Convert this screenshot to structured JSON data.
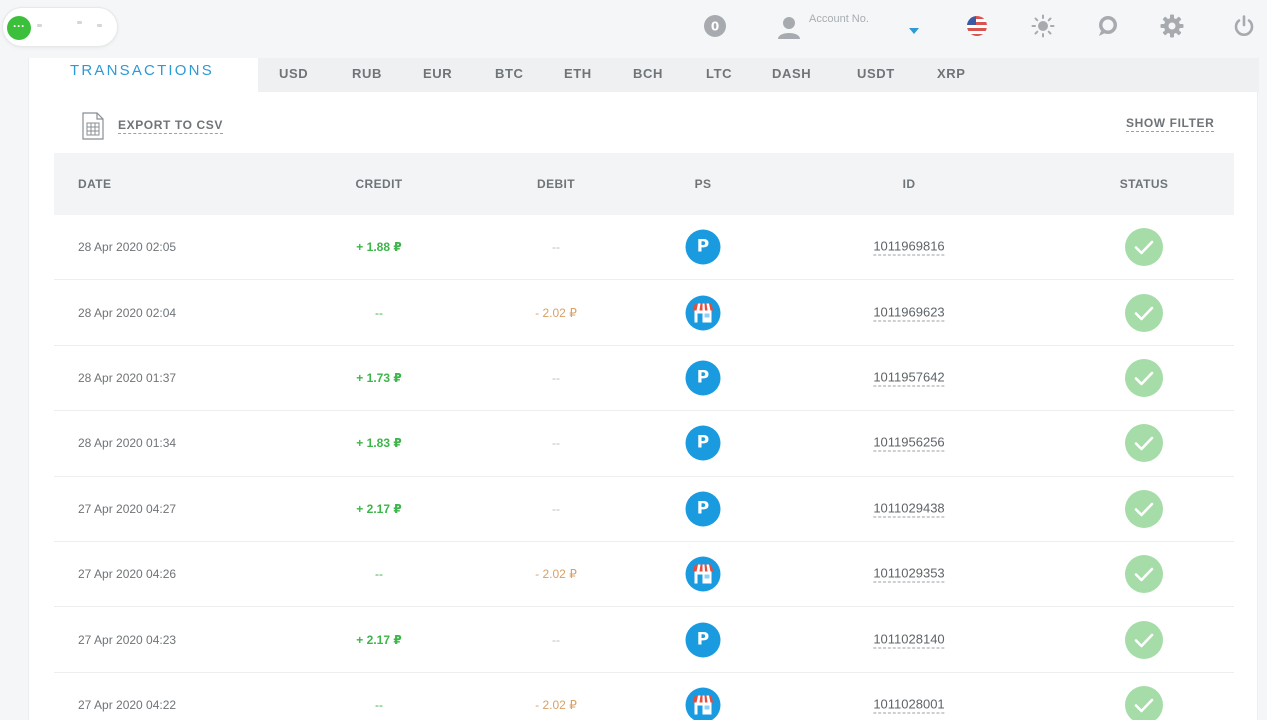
{
  "header": {
    "account_label": "Account No.",
    "icons": [
      "notification-count-icon",
      "user-icon",
      "us-flag-icon",
      "sun-icon",
      "chat-icon",
      "gear-icon",
      "power-icon"
    ],
    "badge_count": "0"
  },
  "tabs": {
    "main": "TRANSACTIONS",
    "currencies": [
      "USD",
      "RUB",
      "EUR",
      "BTC",
      "ETH",
      "BCH",
      "LTC",
      "DASH",
      "USDT",
      "XRP"
    ]
  },
  "toolbar": {
    "export_label": "EXPORT TO CSV",
    "filter_label": "SHOW FILTER"
  },
  "table": {
    "columns": [
      "DATE",
      "CREDIT",
      "DEBIT",
      "PS",
      "ID",
      "STATUS"
    ],
    "rows": [
      {
        "date": "28 Apr 2020 02:05",
        "credit": "+ 1.88 ₽",
        "debit": "--",
        "ps": "P",
        "id": "1011969816"
      },
      {
        "date": "28 Apr 2020 02:04",
        "credit": "--",
        "debit": "- 2.02 ₽",
        "ps": "shop",
        "id": "1011969623"
      },
      {
        "date": "28 Apr 2020 01:37",
        "credit": "+ 1.73 ₽",
        "debit": "--",
        "ps": "P",
        "id": "1011957642"
      },
      {
        "date": "28 Apr 2020 01:34",
        "credit": "+ 1.83 ₽",
        "debit": "--",
        "ps": "P",
        "id": "1011956256"
      },
      {
        "date": "27 Apr 2020 04:27",
        "credit": "+ 2.17 ₽",
        "debit": "--",
        "ps": "P",
        "id": "1011029438"
      },
      {
        "date": "27 Apr 2020 04:26",
        "credit": "--",
        "debit": "- 2.02 ₽",
        "ps": "shop",
        "id": "1011029353"
      },
      {
        "date": "27 Apr 2020 04:23",
        "credit": "+ 2.17 ₽",
        "debit": "--",
        "ps": "P",
        "id": "1011028140"
      },
      {
        "date": "27 Apr 2020 04:22",
        "credit": "--",
        "debit": "- 2.02 ₽",
        "ps": "shop",
        "id": "1011028001"
      }
    ]
  },
  "colors": {
    "accent": "#2c9ad6",
    "credit": "#3db54a",
    "debit": "#d9a066",
    "status_ok": "#a5dca8",
    "ps_blue": "#1a9be0"
  }
}
